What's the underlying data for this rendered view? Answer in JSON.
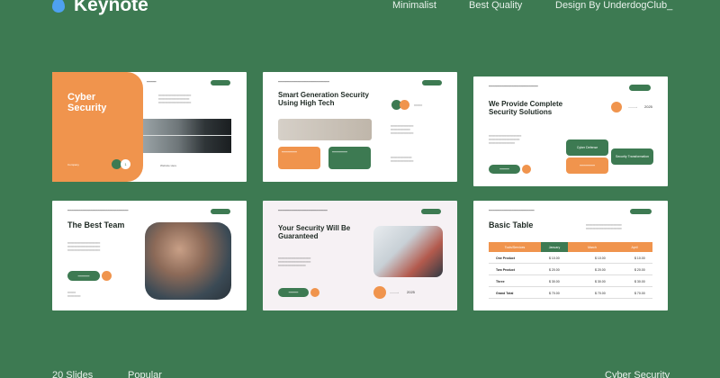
{
  "brand": {
    "name": "Keynote"
  },
  "nav": [
    "Minimalist",
    "Best Quality",
    "Design By UnderdogClub_"
  ],
  "bottom": [
    "20 Slides",
    "Popular",
    "Cyber Security"
  ],
  "colors": {
    "background": "#3d7a52",
    "accent": "#f0944d",
    "green": "#3d7a52"
  },
  "slides": {
    "s1": {
      "title": "Cyber Security",
      "company": "Company",
      "num": "1",
      "website": "Website Here"
    },
    "s2": {
      "title": "Smart Generation Security Using High Tech"
    },
    "s3": {
      "title": "We Provide Complete Security Solutions",
      "year": "2025",
      "box1": "Cyber Defense",
      "box2": "Security Transformation"
    },
    "s4": {
      "title": "The Best Team"
    },
    "s5": {
      "title": "Your Security Will Be Guaranteed",
      "year": "2025"
    },
    "s6": {
      "title": "Basic Table",
      "columns": [
        "Tools/Services",
        "January",
        "March",
        "April"
      ],
      "rows": [
        {
          "label": "One Product",
          "v1": "$ 10.00",
          "v2": "$ 10.00",
          "v3": "$ 10.00"
        },
        {
          "label": "Two Product",
          "v1": "$ 20.00",
          "v2": "$ 20.00",
          "v3": "$ 20.00"
        },
        {
          "label": "Three",
          "v1": "$ 30.00",
          "v2": "$ 30.00",
          "v3": "$ 30.00"
        },
        {
          "label": "Grand Total",
          "v1": "$ 70.00",
          "v2": "$ 70.00",
          "v3": "$ 70.00"
        }
      ]
    }
  }
}
